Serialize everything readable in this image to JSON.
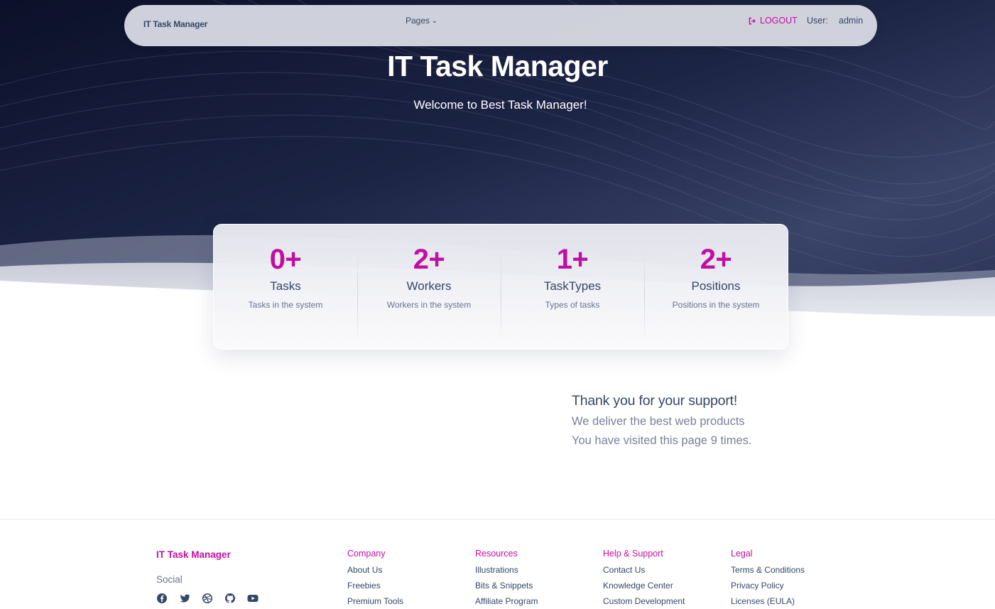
{
  "colors": {
    "accent": "#cb0c9f",
    "hero_dark": "#0d1230",
    "text_dark": "#344767",
    "text_muted": "#7b809a"
  },
  "navbar": {
    "brand": "IT Task Manager",
    "pages_label": "Pages",
    "logout_label": "LOGOUT",
    "user_label": "User:",
    "username": "admin"
  },
  "hero": {
    "title": "IT Task Manager",
    "subtitle": "Welcome to Best Task Manager!"
  },
  "stats": [
    {
      "value": "0+",
      "label": "Tasks",
      "description": "Tasks in the system"
    },
    {
      "value": "2+",
      "label": "Workers",
      "description": "Workers in the system"
    },
    {
      "value": "1+",
      "label": "TaskTypes",
      "description": "Types of tasks"
    },
    {
      "value": "2+",
      "label": "Positions",
      "description": "Positions in the system"
    }
  ],
  "thanks": {
    "heading": "Thank you for your support!",
    "line1": "We deliver the best web products",
    "line2": "You have visited this page 9 times."
  },
  "footer": {
    "brand": "IT Task Manager",
    "social_label": "Social",
    "social_icons": [
      "facebook-icon",
      "twitter-icon",
      "dribbble-icon",
      "github-icon",
      "youtube-icon"
    ],
    "columns": [
      {
        "title": "Company",
        "links": [
          "About Us",
          "Freebies",
          "Premium Tools"
        ]
      },
      {
        "title": "Resources",
        "links": [
          "Illustrations",
          "Bits & Snippets",
          "Affiliate Program"
        ]
      },
      {
        "title": "Help & Support",
        "links": [
          "Contact Us",
          "Knowledge Center",
          "Custom Development"
        ]
      },
      {
        "title": "Legal",
        "links": [
          "Terms & Conditions",
          "Privacy Policy",
          "Licenses (EULA)"
        ]
      }
    ]
  }
}
